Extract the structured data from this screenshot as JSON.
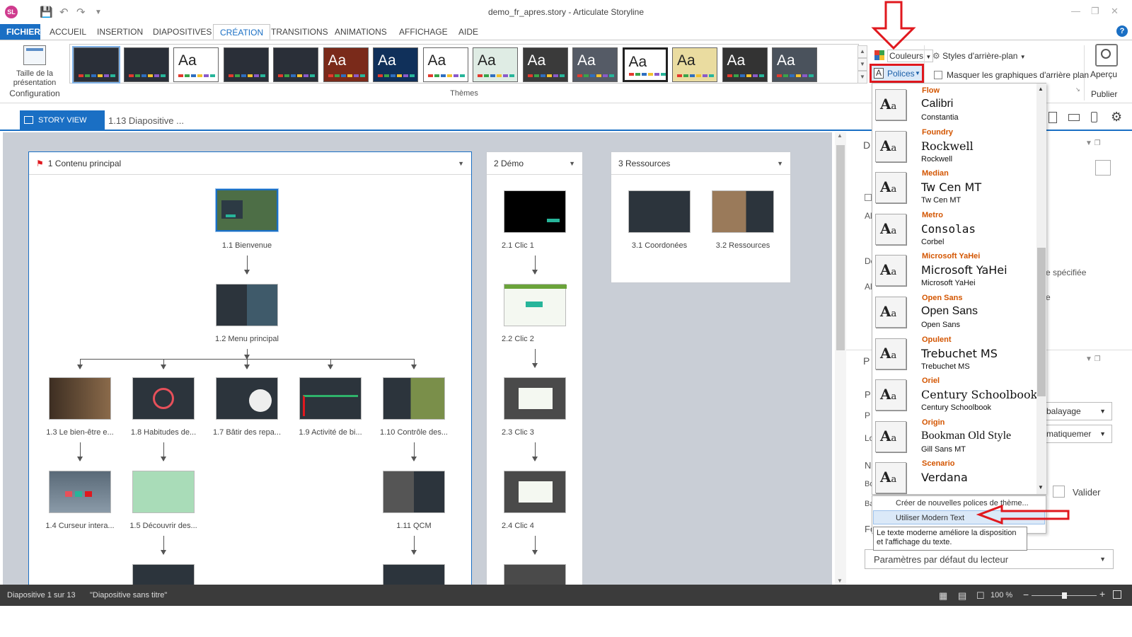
{
  "window": {
    "title": "demo_fr_apres.story - Articulate Storyline",
    "logo": "SL"
  },
  "menu": [
    "FICHIER",
    "ACCUEIL",
    "INSERTION",
    "DIAPOSITIVES",
    "CRÉATION",
    "TRANSITIONS",
    "ANIMATIONS",
    "AFFICHAGE",
    "AIDE"
  ],
  "ribbon": {
    "config_label_1": "Taille de la",
    "config_label_2": "présentation",
    "config_group": "Configuration",
    "themes_group": "Thèmes",
    "theme_aa": "Aa",
    "colors_btn": "Couleurs",
    "fonts_btn": "Polices",
    "bg_styles_btn": "Styles d'arrière-plan",
    "hide_bg_label": "Masquer les graphiques d'arrière plan",
    "preview_label": "Aperçu",
    "publish_label": "Publier"
  },
  "storyview": {
    "tab_label": "STORY VIEW",
    "breadcrumb": "1.13 Diapositive ..."
  },
  "scenes": [
    {
      "title": "1 Contenu principal"
    },
    {
      "title": "2 Démo"
    },
    {
      "title": "3 Ressources"
    }
  ],
  "slides": {
    "s11": "1.1 Bienvenue",
    "s12": "1.2 Menu principal",
    "s13": "1.3 Le bien-être e...",
    "s18": "1.8 Habitudes de...",
    "s17": "1.7 Bâtir des repa...",
    "s19": "1.9 Activité de bi...",
    "s110": "1.10 Contrôle des...",
    "s14": "1.4 Curseur intera...",
    "s15": "1.5 Découvrir des...",
    "s111": "1.11 QCM",
    "d1": "2.1 Clic 1",
    "d2": "2.2 Clic 2",
    "d3": "2.3 Clic 3",
    "d4": "2.4 Clic 4",
    "r1": "3.1 Coordonées",
    "r2": "3.2 Ressources"
  },
  "fonts": [
    {
      "name": "Flow",
      "heading": "Calibri",
      "body": "Constantia"
    },
    {
      "name": "Foundry",
      "heading": "Rockwell",
      "body": "Rockwell"
    },
    {
      "name": "Median",
      "heading": "Tw Cen MT",
      "body": "Tw Cen MT"
    },
    {
      "name": "Metro",
      "heading": "Consolas",
      "body": "Corbel"
    },
    {
      "name": "Microsoft YaHei",
      "heading": "Microsoft YaHei",
      "body": "Microsoft YaHei"
    },
    {
      "name": "Open Sans",
      "heading": "Open Sans",
      "body": "Open Sans"
    },
    {
      "name": "Opulent",
      "heading": "Trebuchet MS",
      "body": "Trebuchet MS"
    },
    {
      "name": "Oriel",
      "heading": "Century Schoolbook",
      "body": "Century Schoolbook"
    },
    {
      "name": "Origin",
      "heading": "Bookman Old Style",
      "body": "Gill Sans MT"
    },
    {
      "name": "Scenario",
      "heading": "Verdana",
      "body": ""
    }
  ],
  "font_icon": {
    "big": "A",
    "small": "a"
  },
  "font_menu": {
    "create": "Créer de nouvelles polices de thème...",
    "modern": "Utiliser Modern Text",
    "tooltip_1": "Le texte moderne améliore la disposition",
    "tooltip_2": "et l'affichage du texte."
  },
  "panel": {
    "frag_1": "e spécifiée",
    "frag_2": "e",
    "select_1": "balayage",
    "select_2": "matiquemer",
    "validate": "Valider",
    "player_default": "Paramètres par défaut du lecteur",
    "labels": [
      "D",
      "Al",
      "De",
      "Al",
      "P",
      "P",
      "P",
      "Lo",
      "N",
      "Bo",
      "Ba",
      "Fo"
    ]
  },
  "status": {
    "slide": "Diapositive 1 sur 13",
    "name": "\"Diapositive sans titre\"",
    "zoom": "100 %"
  },
  "colors": {
    "accent": "#1a6fc4",
    "highlight": "#e0181e"
  }
}
